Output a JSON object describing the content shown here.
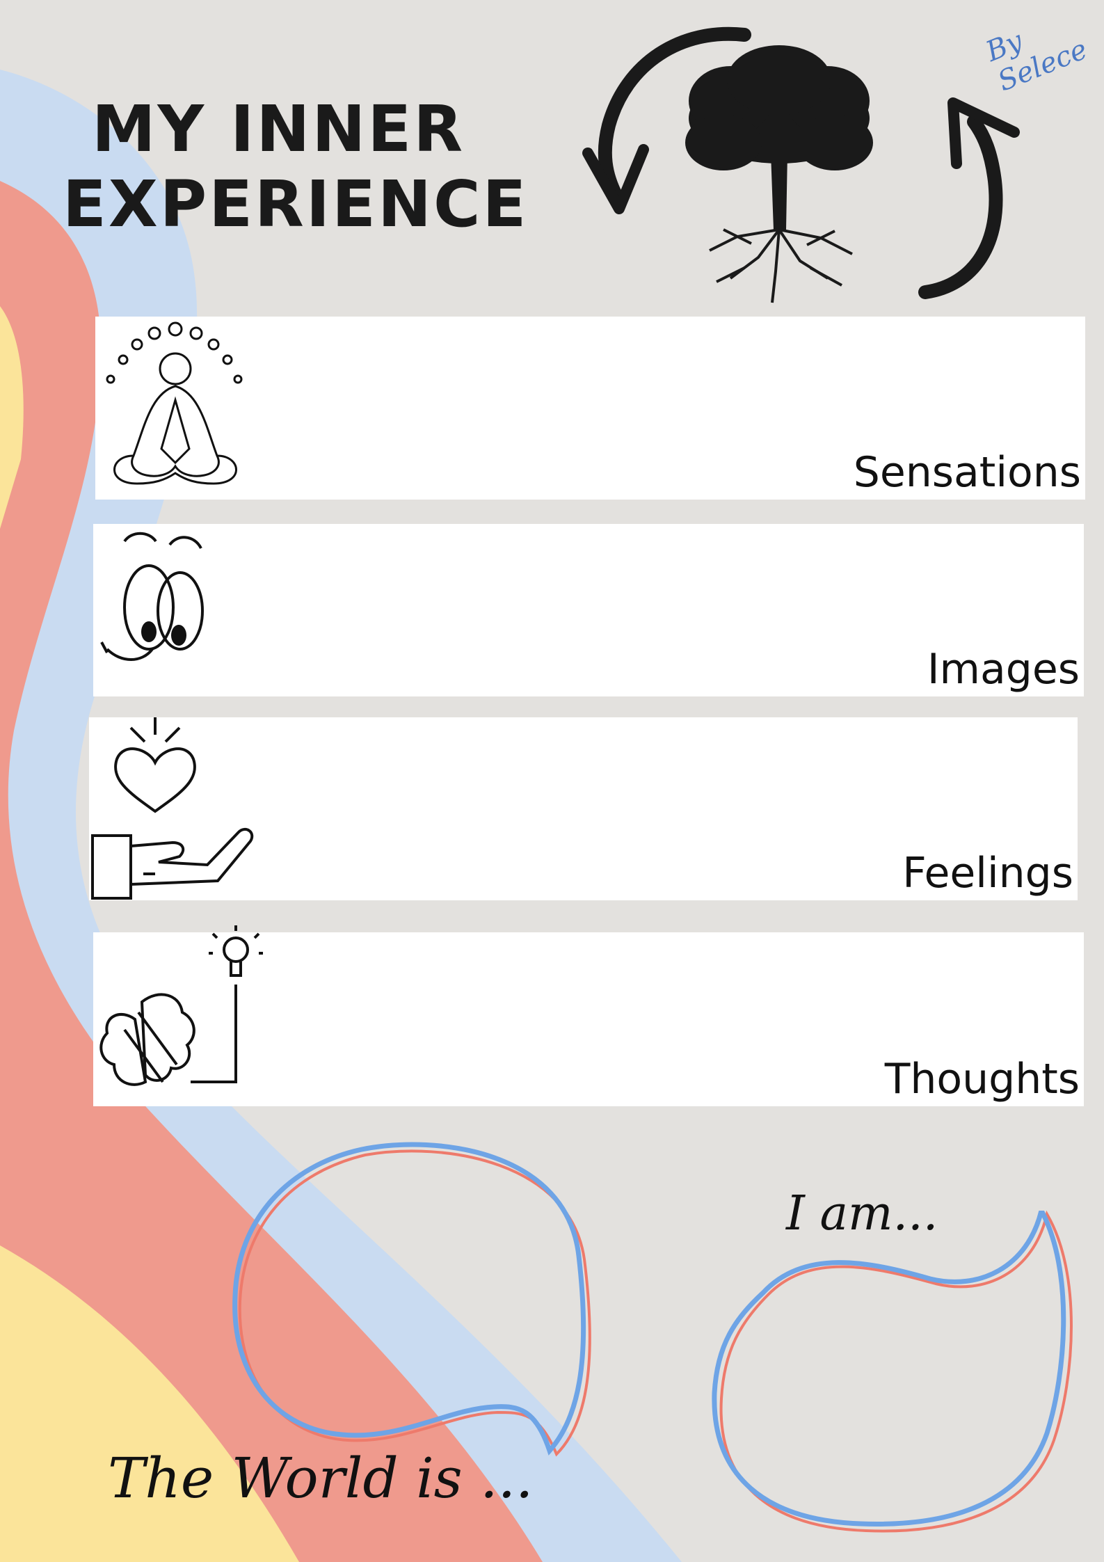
{
  "title": {
    "line1": "MY INNER",
    "line2": "EXPERIENCE"
  },
  "signature": "By Selece",
  "panels": [
    {
      "label": "Sensations",
      "icon": "meditation-icon"
    },
    {
      "label": "Images",
      "icon": "cartoon-eyes-icon"
    },
    {
      "label": "Feelings",
      "icon": "heart-in-hand-icon"
    },
    {
      "label": "Thoughts",
      "icon": "brain-lightbulb-icon"
    }
  ],
  "world_caption": "The World is ...",
  "self_caption": "I am...",
  "colors": {
    "background": "#e3e1de",
    "wave_blue": "#c9dbf1",
    "wave_salmon": "#ef9a8d",
    "wave_yellow": "#fbe49a",
    "bubble_blue": "#6ea4e6",
    "bubble_red": "#ee7a6b",
    "ink": "#1a1a1a"
  },
  "decoration_icons": [
    "tree-icon",
    "cycle-arrow-left-icon",
    "cycle-arrow-right-icon"
  ]
}
